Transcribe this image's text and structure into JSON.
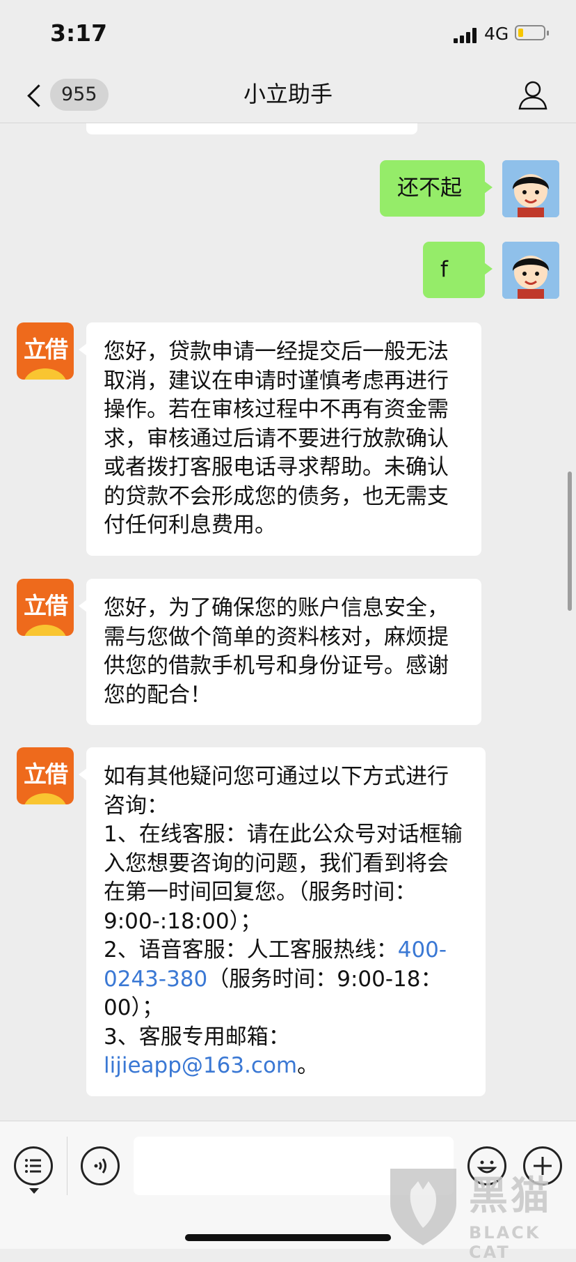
{
  "status_bar": {
    "time": "3:17",
    "network": "4G",
    "battery_level": 0.2
  },
  "nav": {
    "unread_count": "955",
    "title": "小立助手"
  },
  "messages": [
    {
      "from": "me",
      "text": "还不起"
    },
    {
      "from": "me",
      "text": "f"
    },
    {
      "from": "bot",
      "avatar_text": "立借",
      "text": "您好，贷款申请一经提交后一般无法取消，建议在申请时谨慎考虑再进行操作。若在审核过程中不再有资金需求，审核通过后请不要进行放款确认或者拨打客服电话寻求帮助。未确认的贷款不会形成您的债务，也无需支付任何利息费用。"
    },
    {
      "from": "bot",
      "avatar_text": "立借",
      "text": "您好，为了确保您的账户信息安全，需与您做个简单的资料核对，麻烦提供您的借款手机号和身份证号。感谢您的配合！"
    },
    {
      "from": "bot",
      "avatar_text": "立借",
      "text_part1": "如有其他疑问您可通过以下方式进行咨询：",
      "text_part2": "1、在线客服：请在此公众号对话框输入您想要咨询的问题，我们看到将会在第一时间回复您。（服务时间：9:00-:18:00）；",
      "text_part3": "2、语音客服：人工客服热线：",
      "phone": "400-0243-380",
      "text_part4": "（服务时间：9:00-18：00）；",
      "text_part5": "3、客服专用邮箱：",
      "email": "lijieapp@163.com",
      "text_part6": "。"
    }
  ],
  "watermark": {
    "text": "黑猫",
    "en": "BLACK CAT"
  },
  "colors": {
    "my_bubble": "#95ec69",
    "link": "#3a78d4",
    "avatar_bg": "#ee6a1c"
  }
}
